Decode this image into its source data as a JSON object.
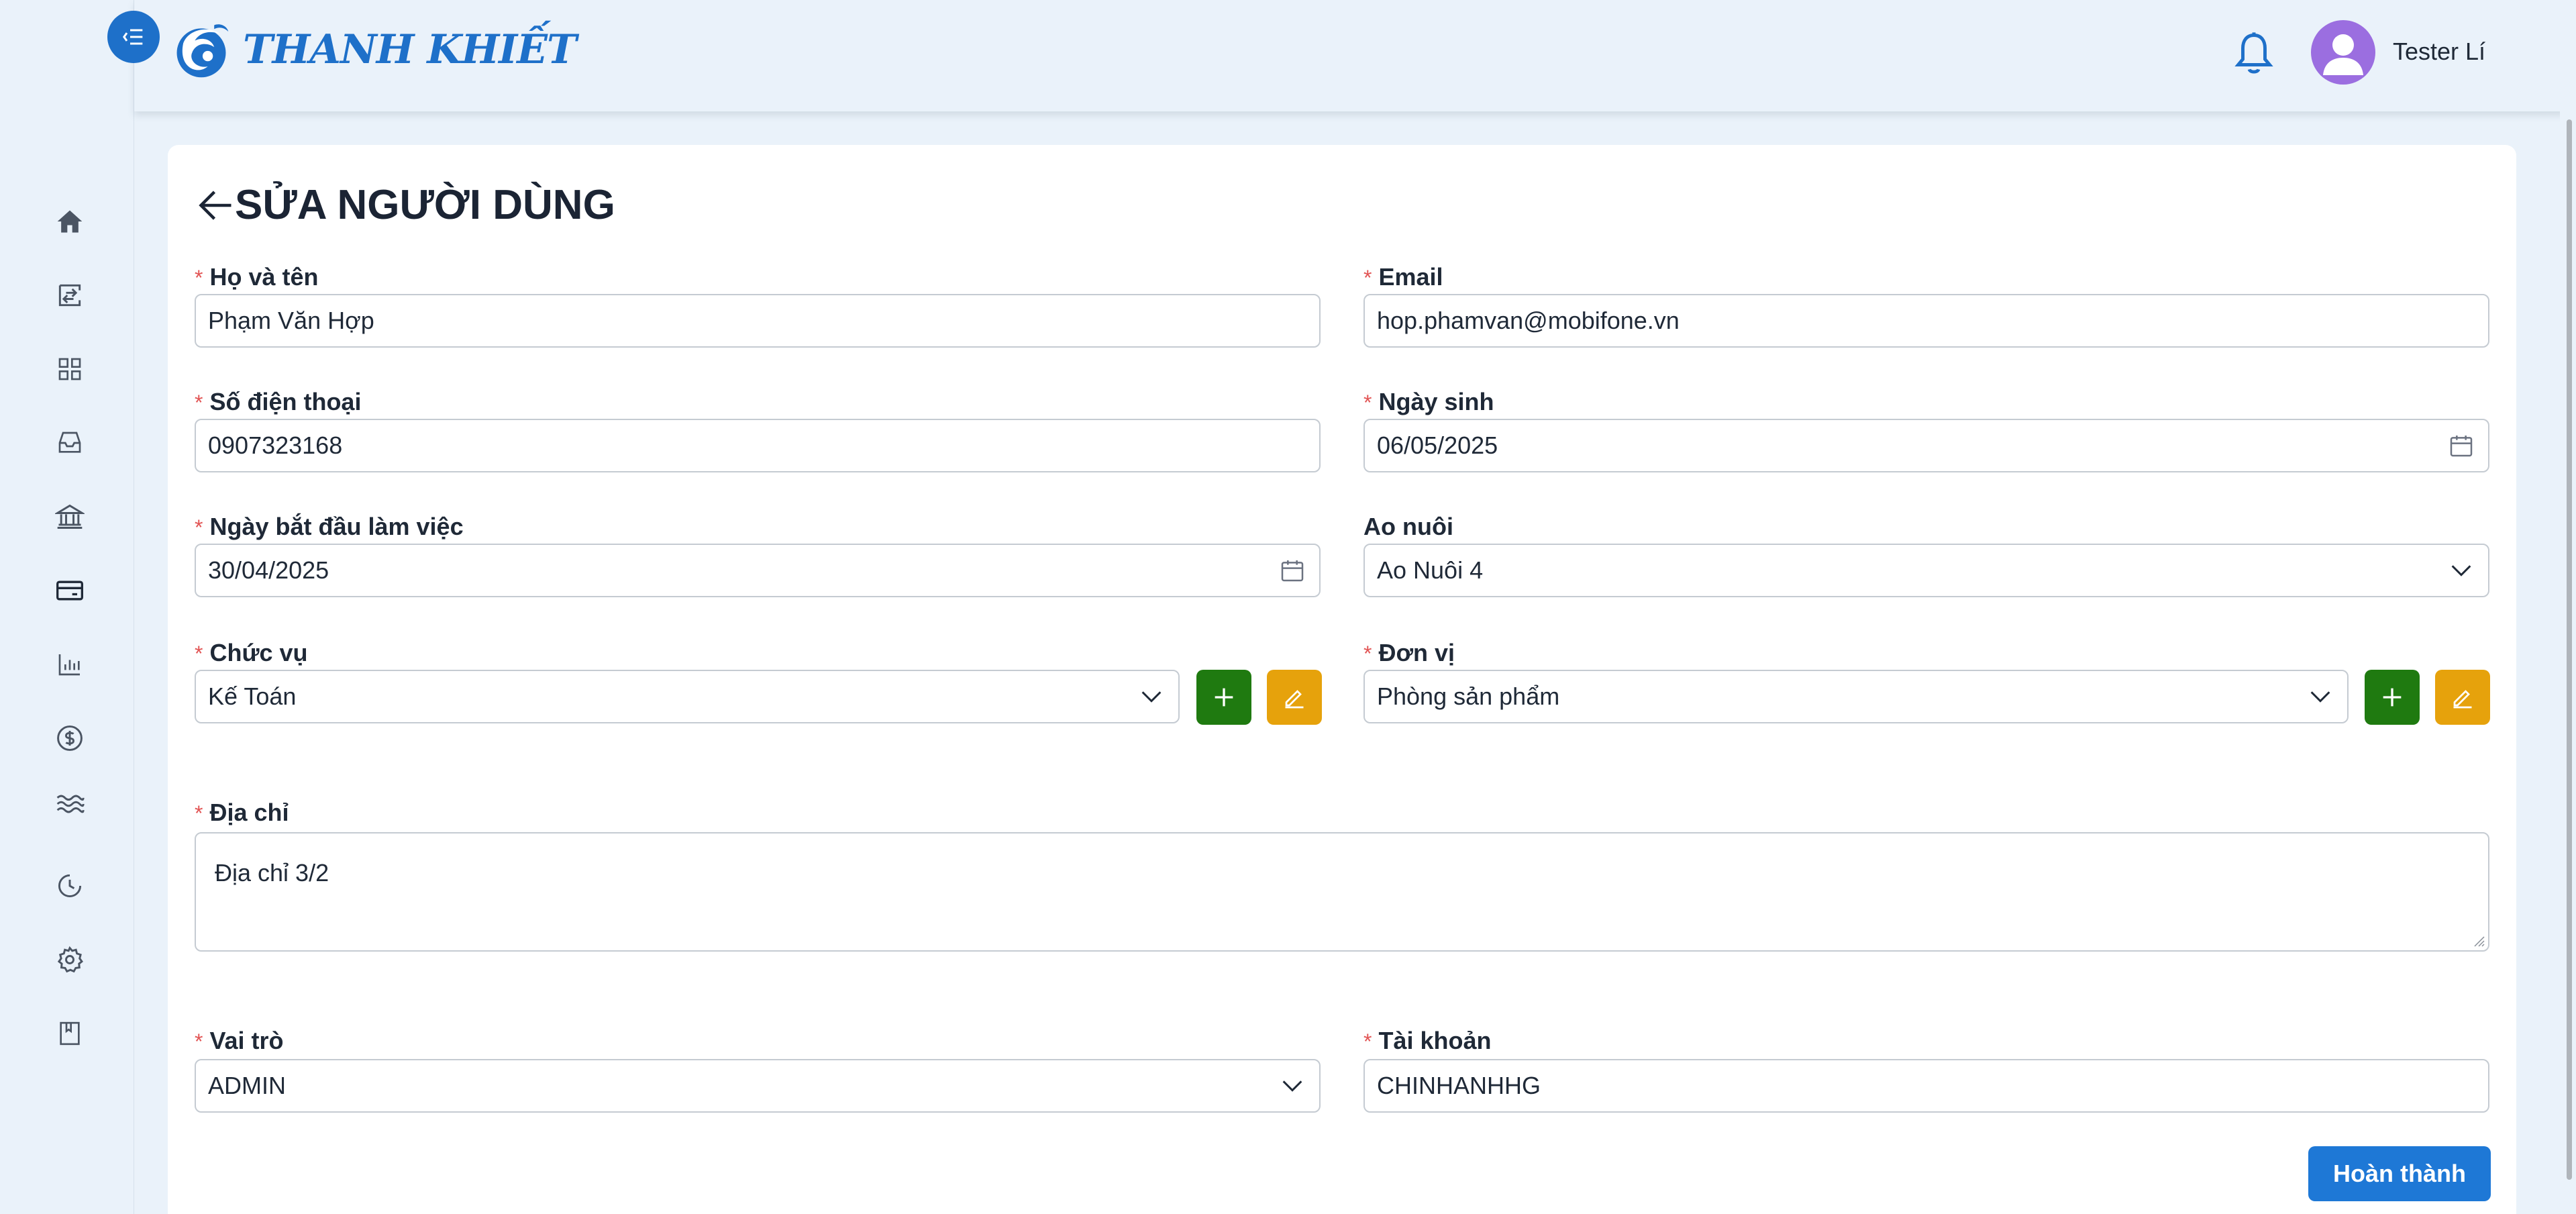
{
  "brand": {
    "name": "THANH KHIẾT"
  },
  "user": {
    "name": "Tester Lí"
  },
  "page": {
    "title": "SỬA NGƯỜI DÙNG"
  },
  "form": {
    "full_name": {
      "label": "Họ và tên",
      "value": "Phạm Văn Hợp"
    },
    "email": {
      "label": "Email",
      "value": "hop.phamvan@mobifone.vn"
    },
    "phone": {
      "label": "Số điện thoại",
      "value": "0907323168"
    },
    "birthday": {
      "label": "Ngày sinh",
      "value": "06/05/2025"
    },
    "start_date": {
      "label": "Ngày bắt đầu làm việc",
      "value": "30/04/2025"
    },
    "pond": {
      "label": "Ao nuôi",
      "value": "Ao Nuôi 4"
    },
    "position": {
      "label": "Chức vụ",
      "value": "Kế Toán"
    },
    "unit": {
      "label": "Đơn vị",
      "value": "Phòng sản phẩm"
    },
    "address": {
      "label": "Địa chỉ",
      "value": "Địa chỉ 3/2"
    },
    "role": {
      "label": "Vai trò",
      "value": "ADMIN"
    },
    "account": {
      "label": "Tài khoản",
      "value": "CHINHANHHG"
    },
    "required_mark": "*",
    "submit_label": "Hoàn thành"
  },
  "sidebar": {
    "items": [
      {
        "icon": "home-icon"
      },
      {
        "icon": "transfer-icon"
      },
      {
        "icon": "grid-icon"
      },
      {
        "icon": "inbox-icon"
      },
      {
        "icon": "bank-icon"
      },
      {
        "icon": "card-icon"
      },
      {
        "icon": "bar-chart-icon"
      },
      {
        "icon": "dollar-icon"
      },
      {
        "icon": "waves-icon"
      },
      {
        "icon": "history-icon"
      },
      {
        "icon": "gear-icon"
      },
      {
        "icon": "bookmark-icon"
      }
    ]
  },
  "colors": {
    "primary": "#1e70c9",
    "background": "#eaf2fa",
    "add_button": "#1f7a10",
    "edit_button": "#e6a20c",
    "required": "#e25555"
  }
}
